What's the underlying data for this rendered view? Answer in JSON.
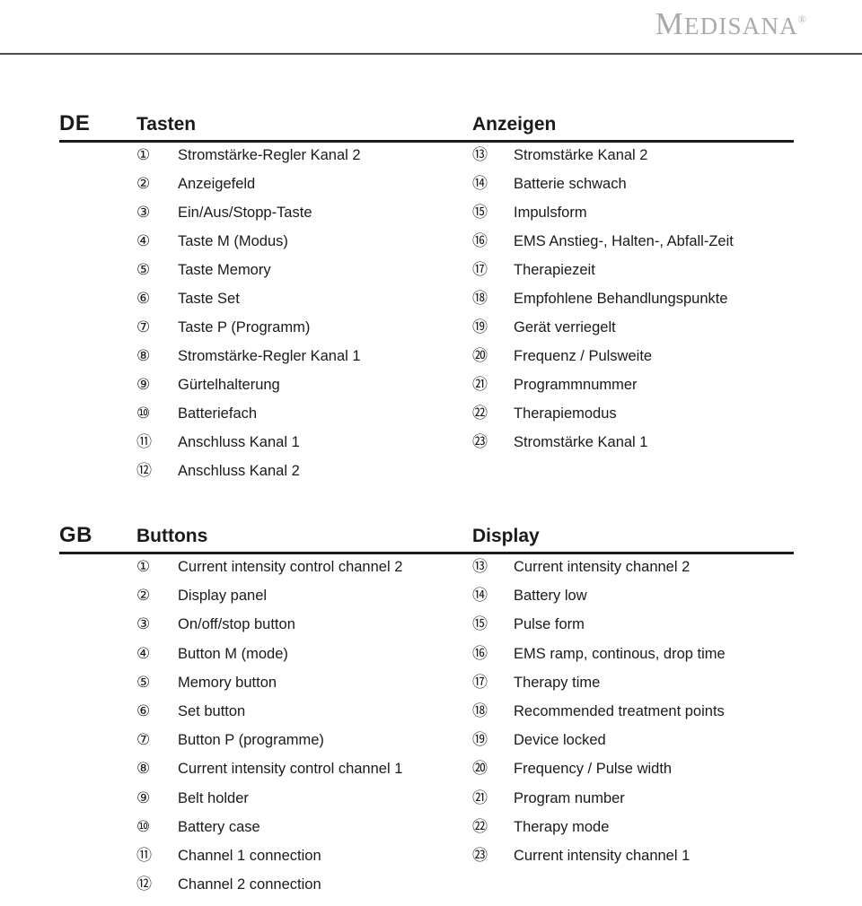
{
  "brand": {
    "name_cap": "M",
    "name_rest": "EDISANA",
    "registered_mark": "®",
    "color": "#a9aaae"
  },
  "rule_color": "#4c4c50",
  "blocks": [
    {
      "id": "de",
      "lang_tag": "DE",
      "left_heading": "Tasten",
      "right_heading": "Anzeigen",
      "left_items": [
        {
          "num": "①",
          "number": "1",
          "label": "Stromstärke-Regler Kanal 2"
        },
        {
          "num": "②",
          "number": "2",
          "label": "Anzeigefeld"
        },
        {
          "num": "③",
          "number": "3",
          "label": "Ein/Aus/Stopp-Taste"
        },
        {
          "num": "④",
          "number": "4",
          "label": "Taste M (Modus)"
        },
        {
          "num": "⑤",
          "number": "5",
          "label": "Taste Memory"
        },
        {
          "num": "⑥",
          "number": "6",
          "label": "Taste Set"
        },
        {
          "num": "⑦",
          "number": "7",
          "label": "Taste P (Programm)"
        },
        {
          "num": "⑧",
          "number": "8",
          "label": "Stromstärke-Regler Kanal 1"
        },
        {
          "num": "⑨",
          "number": "9",
          "label": "Gürtelhalterung"
        },
        {
          "num": "⑩",
          "number": "10",
          "label": "Batteriefach"
        },
        {
          "num": "⑪",
          "number": "11",
          "label": "Anschluss Kanal 1"
        },
        {
          "num": "⑫",
          "number": "12",
          "label": "Anschluss Kanal 2"
        }
      ],
      "right_items": [
        {
          "num": "⑬",
          "number": "13",
          "label": "Stromstärke Kanal 2"
        },
        {
          "num": "⑭",
          "number": "14",
          "label": "Batterie schwach"
        },
        {
          "num": "⑮",
          "number": "15",
          "label": "Impulsform"
        },
        {
          "num": "⑯",
          "number": "16",
          "label": "EMS Anstieg-, Halten-, Abfall-Zeit"
        },
        {
          "num": "⑰",
          "number": "17",
          "label": "Therapiezeit"
        },
        {
          "num": "⑱",
          "number": "18",
          "label": "Empfohlene Behandlungspunkte"
        },
        {
          "num": "⑲",
          "number": "19",
          "label": "Gerät verriegelt"
        },
        {
          "num": "⑳",
          "number": "20",
          "label": "Frequenz / Pulsweite"
        },
        {
          "num": "㉑",
          "number": "21",
          "label": "Programmnummer"
        },
        {
          "num": "㉒",
          "number": "22",
          "label": "Therapiemodus"
        },
        {
          "num": "㉓",
          "number": "23",
          "label": "Stromstärke Kanal 1"
        }
      ]
    },
    {
      "id": "gb",
      "lang_tag": "GB",
      "left_heading": "Buttons",
      "right_heading": "Display",
      "left_items": [
        {
          "num": "①",
          "number": "1",
          "label": "Current intensity control channel 2"
        },
        {
          "num": "②",
          "number": "2",
          "label": "Display panel"
        },
        {
          "num": "③",
          "number": "3",
          "label": "On/off/stop button"
        },
        {
          "num": "④",
          "number": "4",
          "label": "Button M (mode)"
        },
        {
          "num": "⑤",
          "number": "5",
          "label": "Memory button"
        },
        {
          "num": "⑥",
          "number": "6",
          "label": "Set button"
        },
        {
          "num": "⑦",
          "number": "7",
          "label": "Button P (programme)"
        },
        {
          "num": "⑧",
          "number": "8",
          "label": "Current intensity control channel 1"
        },
        {
          "num": "⑨",
          "number": "9",
          "label": "Belt holder"
        },
        {
          "num": "⑩",
          "number": "10",
          "label": "Battery case"
        },
        {
          "num": "⑪",
          "number": "11",
          "label": "Channel 1 connection"
        },
        {
          "num": "⑫",
          "number": "12",
          "label": "Channel 2 connection"
        }
      ],
      "right_items": [
        {
          "num": "⑬",
          "number": "13",
          "label": "Current intensity channel 2"
        },
        {
          "num": "⑭",
          "number": "14",
          "label": "Battery low"
        },
        {
          "num": "⑮",
          "number": "15",
          "label": "Pulse form"
        },
        {
          "num": "⑯",
          "number": "16",
          "label": "EMS ramp, continous, drop time"
        },
        {
          "num": "⑰",
          "number": "17",
          "label": "Therapy time"
        },
        {
          "num": "⑱",
          "number": "18",
          "label": "Recommended treatment points"
        },
        {
          "num": "⑲",
          "number": "19",
          "label": "Device locked"
        },
        {
          "num": "⑳",
          "number": "20",
          "label": "Frequency / Pulse width"
        },
        {
          "num": "㉑",
          "number": "21",
          "label": "Program number"
        },
        {
          "num": "㉒",
          "number": "22",
          "label": "Therapy mode"
        },
        {
          "num": "㉓",
          "number": "23",
          "label": "Current intensity channel 1"
        }
      ]
    }
  ]
}
